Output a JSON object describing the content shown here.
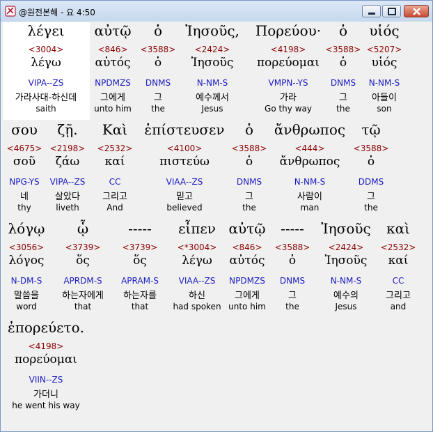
{
  "window": {
    "title": "@원전본해 - 요 4:50",
    "colors": {
      "strong": "#8b0000",
      "parse": "#1a1ac0"
    }
  },
  "words": [
    {
      "greek": "λέγει",
      "strong": "<3004>",
      "lemma": "λέγω",
      "parse": "VIPA--ZS",
      "korean": "가라사대-하신데",
      "english": "saith"
    },
    {
      "greek": "αὐτῷ",
      "strong": "<846>",
      "lemma": "αὐτός",
      "parse": "NPDMZS",
      "korean": "그에게",
      "english": "unto him"
    },
    {
      "greek": "ὁ",
      "strong": "<3588>",
      "lemma": "ὁ",
      "parse": "DNMS",
      "korean": "그",
      "english": "the"
    },
    {
      "greek": "Ἰησοῦς,",
      "strong": "<2424>",
      "lemma": "Ἰησοῦς",
      "parse": "N-NM-S",
      "korean": "예수께서",
      "english": "Jesus"
    },
    {
      "greek": "Πορεύου·",
      "strong": "<4198>",
      "lemma": "πορεύομαι",
      "parse": "VMPN--YS",
      "korean": "가라",
      "english": "Go thy way"
    },
    {
      "greek": "ὁ",
      "strong": "<3588>",
      "lemma": "ὁ",
      "parse": "DNMS",
      "korean": "그",
      "english": "the"
    },
    {
      "greek": "υἱός",
      "strong": "<5207>",
      "lemma": "υἱός",
      "parse": "N-NM-S",
      "korean": "아들이",
      "english": "son"
    },
    {
      "greek": "σου",
      "strong": "<4675>",
      "lemma": "σοῦ",
      "parse": "NPG-YS",
      "korean": "네",
      "english": "thy"
    },
    {
      "greek": "ζῇ.",
      "strong": "<2198>",
      "lemma": "ζάω",
      "parse": "VIPA--ZS",
      "korean": "살았다",
      "english": "liveth"
    },
    {
      "greek": "Καὶ",
      "strong": "<2532>",
      "lemma": "καί",
      "parse": "CC",
      "korean": "그리고",
      "english": "And"
    },
    {
      "greek": "ἐπίστευσεν",
      "strong": "<4100>",
      "lemma": "πιστεύω",
      "parse": "VIAA--ZS",
      "korean": "믿고",
      "english": "believed"
    },
    {
      "greek": "ὁ",
      "strong": "<3588>",
      "lemma": "ὁ",
      "parse": "DNMS",
      "korean": "그",
      "english": "the"
    },
    {
      "greek": "ἄνθρωπος",
      "strong": "<444>",
      "lemma": "ἄνθρωπος",
      "parse": "N-NM-S",
      "korean": "사람이",
      "english": "man"
    },
    {
      "greek": "τῷ",
      "strong": "<3588>",
      "lemma": "ὁ",
      "parse": "DDMS",
      "korean": "그",
      "english": "the"
    },
    {
      "greek": "λόγῳ",
      "strong": "<3056>",
      "lemma": "λόγος",
      "parse": "N-DM-S",
      "korean": "말씀을",
      "english": "word"
    },
    {
      "greek": "ᾧ",
      "strong": "<3739>",
      "lemma": "ὅς",
      "parse": "APRDM-S",
      "korean": "하는자에게",
      "english": "that"
    },
    {
      "greek": "-----",
      "strong": "<3739>",
      "lemma": "ὅς",
      "parse": "APRAM-S",
      "korean": "하는자를",
      "english": "that"
    },
    {
      "greek": "εἶπεν",
      "strong": "<*3004>",
      "lemma": "λέγω",
      "parse": "VIAA--ZS",
      "korean": "하신",
      "english": "had spoken"
    },
    {
      "greek": "αὐτῷ",
      "strong": "<846>",
      "lemma": "αὐτός",
      "parse": "NPDMZS",
      "korean": "그에게",
      "english": "unto him"
    },
    {
      "greek": "-----",
      "strong": "<3588>",
      "lemma": "ὁ",
      "parse": "DNMS",
      "korean": "그",
      "english": "the"
    },
    {
      "greek": "Ἰησοῦς",
      "strong": "<2424>",
      "lemma": "Ἰησοῦς",
      "parse": "N-NM-S",
      "korean": "예수의",
      "english": "Jesus"
    },
    {
      "greek": "καὶ",
      "strong": "<2532>",
      "lemma": "καί",
      "parse": "CC",
      "korean": "그리고",
      "english": "and"
    },
    {
      "greek": "ἐπορεύετο.",
      "strong": "<4198>",
      "lemma": "πορεύομαι",
      "parse": "VIIN--ZS",
      "korean": "가더니",
      "english": "he went his way"
    }
  ]
}
